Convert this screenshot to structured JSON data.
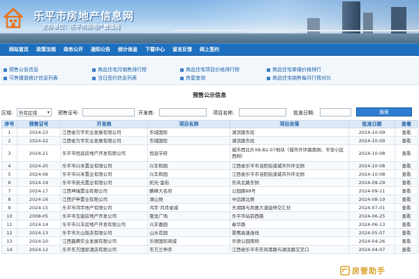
{
  "header": {
    "site_title": "乐平市房地产信息网",
    "sponsor": "主办单位：乐平市房地产管理局"
  },
  "nav": {
    "items": [
      "网站首页",
      "政策法规",
      "政务公开",
      "通知公告",
      "统计信息",
      "下载中心",
      "留言反馈",
      "网上签约"
    ]
  },
  "quick_links": [
    "预售公告信息",
    "商品住宅月销售排行榜",
    "商品住宅项目价格排行榜",
    "商品住宅单幢价格排行",
    "可售楼盘统计信息列表",
    "当日签约信息列表",
    "房屋查询",
    "商品住宅销售每月行情对比"
  ],
  "section_title": "预售公示信息",
  "filters": {
    "region_label": "区域:",
    "region_value": "所有区域",
    "presale_no_label": "预售证号:",
    "developer_label": "开发商:",
    "project_label": "项目名称:",
    "approval_date_label": "批准日期:",
    "search_button": "搜索"
  },
  "table": {
    "headers": [
      "序号",
      "预售证号",
      "开发商",
      "项目名称",
      "项目坐落",
      "批准日期",
      "查看"
    ],
    "rows": [
      [
        "1",
        "2024-23",
        "江西省万宇实业发展有限公司",
        "东城国际",
        "湖滨路东段",
        "2024-10-09",
        "查看"
      ],
      [
        "2",
        "2024-22",
        "江西省万宇实业发展有限公司",
        "东城国际",
        "湖滨路东段",
        "2024-10-09",
        "查看"
      ],
      [
        "3",
        "2024-21",
        "乐平市恒昌房地产开发有限公司",
        "恒昌学府",
        "城市西北片XB-B2-07地块（城市外环路南侧、平安小区西侧）",
        "2024-10-08",
        "查看"
      ],
      [
        "4",
        "2024-20",
        "乐平市兴禾置业有限公司",
        "兴丰和园",
        "江西省乐平市洎阳街道城市外环北侧",
        "2024-10-08",
        "查看"
      ],
      [
        "5",
        "2024-06",
        "乐平市兴禾置业有限公司",
        "兴丰和园",
        "江西省乐平市洎阳街道城市外环北侧",
        "2024-10-08",
        "查看"
      ],
      [
        "6",
        "2024-19",
        "乐平市凯光置业有限公司",
        "凯光·金街",
        "东风北路东侧",
        "2024-09-29",
        "查看"
      ],
      [
        "7",
        "2024-17",
        "江西坤瑞置业有限公司",
        "麟峰大名府",
        "公园路88号",
        "2024-09-11",
        "查看"
      ],
      [
        "8",
        "2024-16",
        "江西沪申置业有限公司",
        "湖山悦",
        "中远路北侧",
        "2024-08-19",
        "查看"
      ],
      [
        "9",
        "2024-15",
        "乐平市鸿宇地产有限公司",
        "鸿宇·月月星城",
        "天湖路与凤凰大道延伸交汇处",
        "2024-07-01",
        "查看"
      ],
      [
        "10",
        "2008-05",
        "乐平市玉骏房地产开发公司",
        "聚龙广场",
        "乐平市站前西路",
        "2024-06-25",
        "查看"
      ],
      [
        "11",
        "2024-14",
        "乐平市兴丰房地产开发有限公司",
        "兴丰嘉园",
        "春华路",
        "2024-06-13",
        "查看"
      ],
      [
        "12",
        "2024-13",
        "乐平市大山饭店有限公司",
        "山水花园",
        "景鹰高速连线",
        "2024-05-07",
        "查看"
      ],
      [
        "13",
        "2024-10",
        "江西鑫腾实业发展有限公司",
        "乐德国际商城",
        "乐德公园南侧",
        "2024-04-26",
        "查看"
      ],
      [
        "14",
        "2024-12",
        "乐平东方国际酒店有限公司",
        "东方兰亭序",
        "江西省乐平市东风南路与湖滨路交叉口",
        "2024-04-07",
        "查看"
      ]
    ]
  },
  "watermark": {
    "text": "房管助手"
  }
}
